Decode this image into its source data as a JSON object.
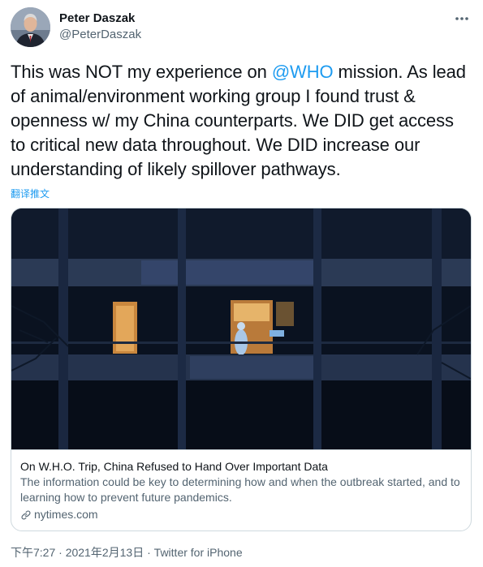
{
  "author": {
    "name": "Peter Daszak",
    "handle": "@PeterDaszak"
  },
  "tweet": {
    "text_before": "This was NOT my experience on ",
    "mention": "@WHO",
    "text_after": " mission. As lead of animal/environment working group I found trust & openness w/ my China counterparts. We DID get access to critical new data throughout. We DID increase our understanding of likely spillover pathways.",
    "translate_label": "翻译推文"
  },
  "card": {
    "title": "On W.H.O. Trip, China Refused to Hand Over Important Data",
    "description": "The information could be key to determining how and when the outbreak started, and to learning how to prevent future pandemics.",
    "domain": "nytimes.com"
  },
  "meta": {
    "time": "下午7:27",
    "separator": " · ",
    "date": "2021年2月13日",
    "source": "Twitter for iPhone"
  },
  "icons": {
    "more": "more-horizontal-icon",
    "link": "link-icon"
  }
}
